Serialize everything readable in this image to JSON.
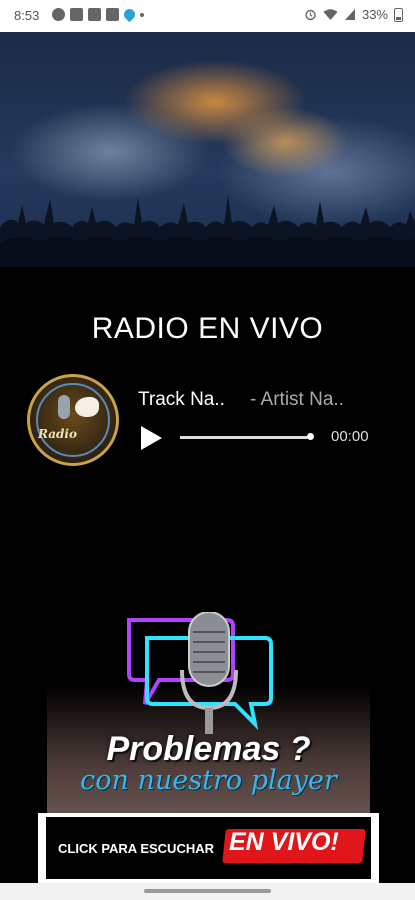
{
  "status_bar": {
    "time": "8:53",
    "battery": "33%",
    "left_icons": [
      "messenger-icon",
      "m-icon",
      "facebook-icon",
      "gallery-icon",
      "location-icon",
      "more-dots-icon"
    ],
    "right_icons": [
      "alarm-icon",
      "wifi-icon",
      "signal-icon",
      "battery-icon"
    ]
  },
  "player": {
    "section_title": "RADIO EN VIVO",
    "logo_text": "Radio",
    "track_name": "Track Na..",
    "artist_name": "- Artist Na..",
    "elapsed": "00:00",
    "progress": 0.98
  },
  "promo": {
    "title": "Problemas ?",
    "subtitle": "con nuestro player"
  },
  "cta": {
    "text": "CLICK PARA ESCUCHAR",
    "badge": "EN VIVO!"
  },
  "colors": {
    "background": "#000000",
    "accent_blue": "#38b6e8",
    "accent_red": "#e0161a",
    "neon_purple": "#b043ff",
    "neon_cyan": "#2fe2ff"
  }
}
